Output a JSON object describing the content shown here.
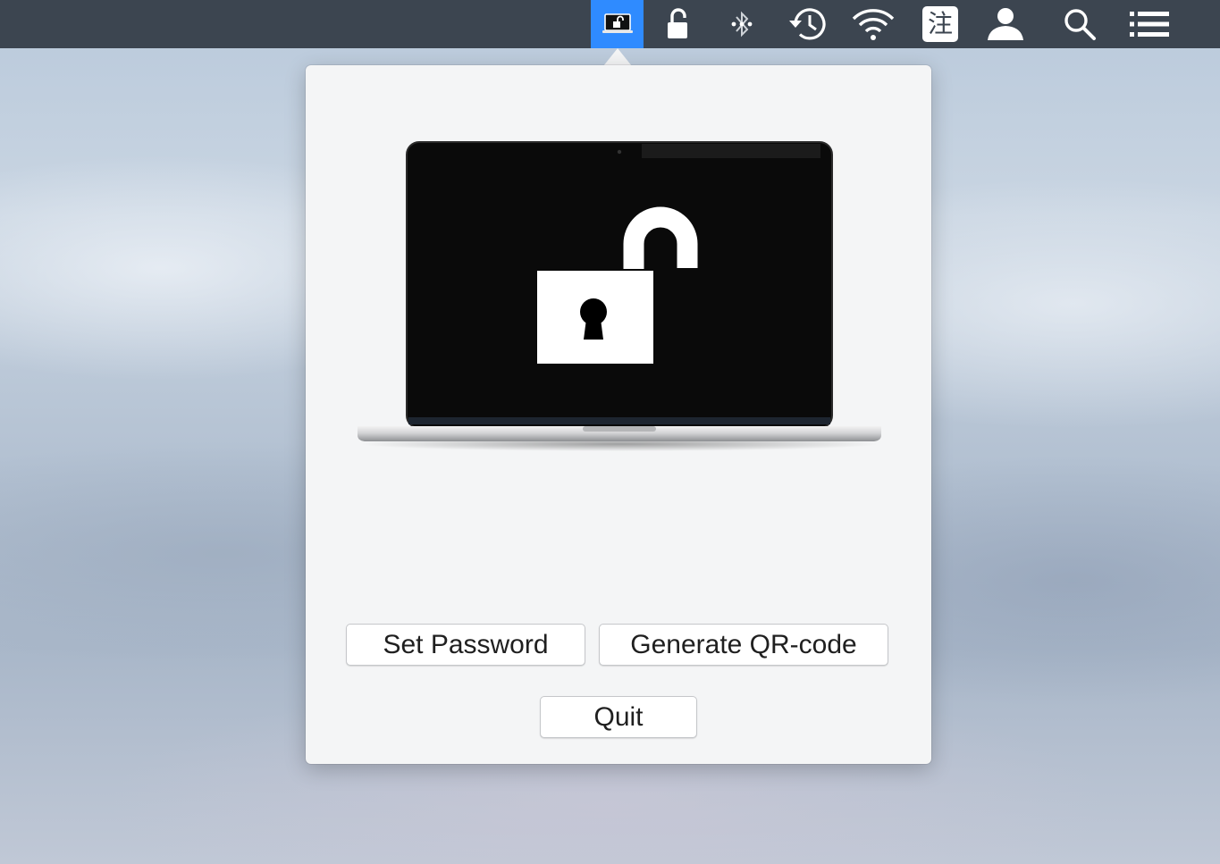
{
  "menubar": {
    "icons": [
      "laptop-lock-app-icon",
      "lock-icon",
      "bluetooth-icon",
      "time-machine-icon",
      "wifi-icon",
      "input-method-icon",
      "user-icon",
      "spotlight-search-icon",
      "notification-center-icon"
    ],
    "input_method_label": "注",
    "active_color": "#2f8bff",
    "bar_color": "#3c4550"
  },
  "popover": {
    "illustration": "laptop-unlocked-padlock-icon",
    "buttons": {
      "set_password": "Set Password",
      "generate_qr": "Generate QR-code",
      "quit": "Quit"
    }
  }
}
